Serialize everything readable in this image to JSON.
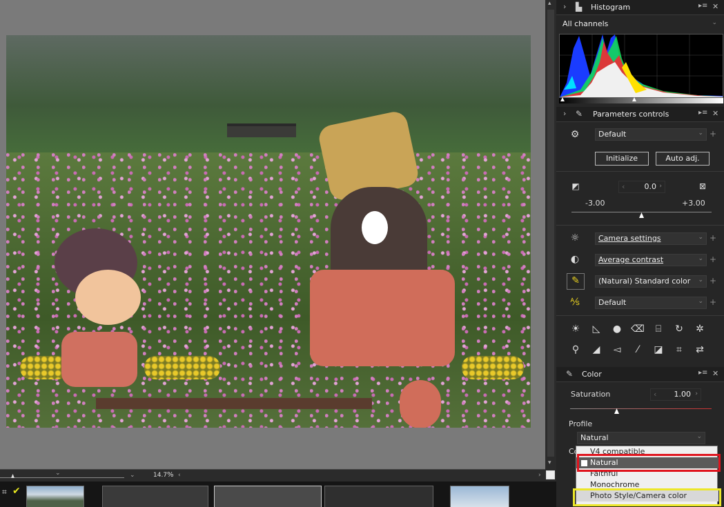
{
  "histogram": {
    "title": "Histogram",
    "channel": "All channels"
  },
  "params": {
    "title": "Parameters controls",
    "preset": "Default",
    "initialize": "Initialize",
    "auto_adj": "Auto adj.",
    "exposure_value": "0.0",
    "exposure_min": "-3.00",
    "exposure_max": "+3.00",
    "white_balance": "Camera settings",
    "contrast": "Average contrast",
    "picture_control": "(Natural) Standard color",
    "default2": "Default"
  },
  "color": {
    "title": "Color",
    "saturation_label": "Saturation",
    "saturation_value": "1.00",
    "profile_label": "Profile",
    "profile_value": "Natural",
    "color_label_partial": "Co"
  },
  "dropdown": {
    "options": [
      "V4 compatible",
      "Natural",
      "Faithful",
      "Monochrome",
      "Photo Style/Camera color"
    ],
    "selected_index": 1
  },
  "viewer": {
    "zoom": "14.7",
    "zoom_unit": "%"
  },
  "colors": {
    "highlight_red": "#e0141e",
    "highlight_yellow": "#ece72a",
    "panel_bg": "#262626"
  }
}
